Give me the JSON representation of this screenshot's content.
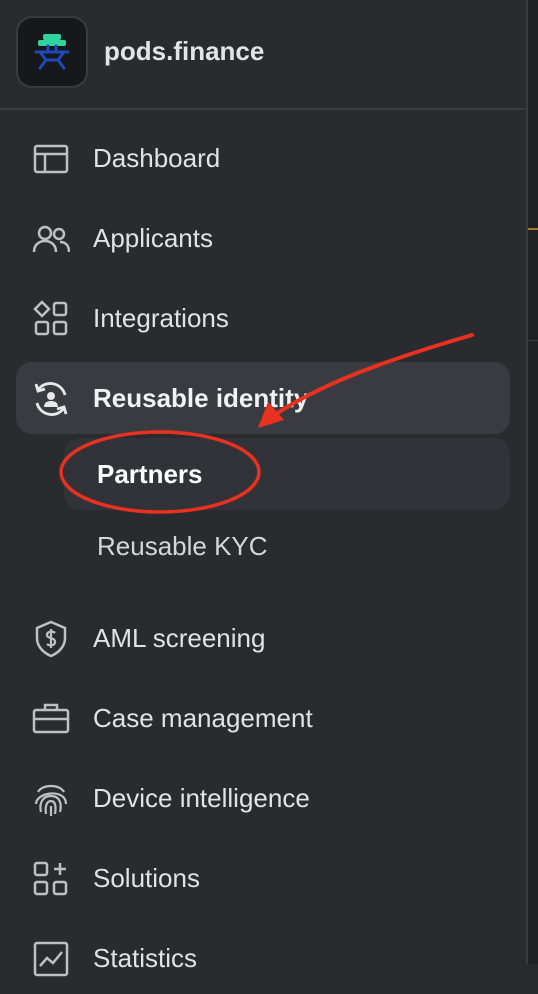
{
  "brand": {
    "name": "pods.finance",
    "logo_icon": "pods-logo-icon"
  },
  "nav": {
    "items": [
      {
        "label": "Dashboard",
        "icon": "layout-icon"
      },
      {
        "label": "Applicants",
        "icon": "users-icon"
      },
      {
        "label": "Integrations",
        "icon": "integrations-icon"
      },
      {
        "label": "Reusable identity",
        "icon": "reusable-identity-icon",
        "active": true
      },
      {
        "label": "AML screening",
        "icon": "shield-dollar-icon"
      },
      {
        "label": "Case management",
        "icon": "briefcase-icon"
      },
      {
        "label": "Device intelligence",
        "icon": "fingerprint-icon"
      },
      {
        "label": "Solutions",
        "icon": "solutions-icon"
      },
      {
        "label": "Statistics",
        "icon": "chart-icon"
      }
    ],
    "sub_items": [
      {
        "label": "Partners",
        "selected": true
      },
      {
        "label": "Reusable KYC",
        "selected": false
      }
    ]
  },
  "colors": {
    "background": "#2a2b2f",
    "active_bg": "#3a3b40",
    "annotation": "#e8321f"
  }
}
